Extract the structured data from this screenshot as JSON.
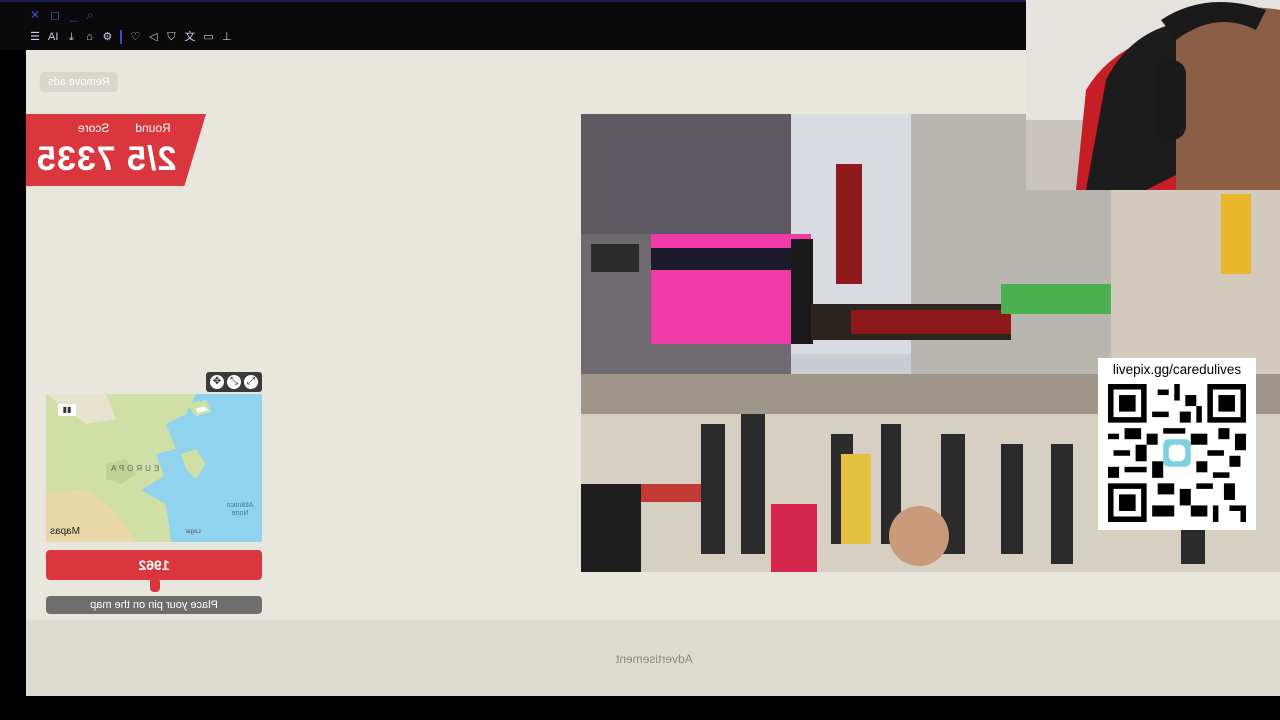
{
  "browser": {
    "window_controls": [
      "✕",
      "◻",
      "_",
      "⌕"
    ],
    "toolbar_icons": [
      "menu-icon",
      "ai-icon",
      "download-icon",
      "extension-icon",
      "settings-icon",
      "heart-icon",
      "send-icon",
      "shield-icon",
      "translate-icon",
      "clipboard-icon",
      "pin-icon"
    ],
    "toolbar_ai_label": "AI"
  },
  "game": {
    "remove_ads": "Remove ads",
    "round_label": "Round",
    "score_label": "Score",
    "round_value": "2/5",
    "score_value": "7335",
    "map": {
      "region_label": "EUROPA",
      "ocean_label": "Atlântico Norte",
      "brand": "Mapas",
      "legal": "Legal"
    },
    "year": "1962",
    "place_pin": "Place your pin on the map",
    "advertisement": "Advertisement"
  },
  "stream": {
    "donation_url": "livepix.gg/caredulives"
  }
}
